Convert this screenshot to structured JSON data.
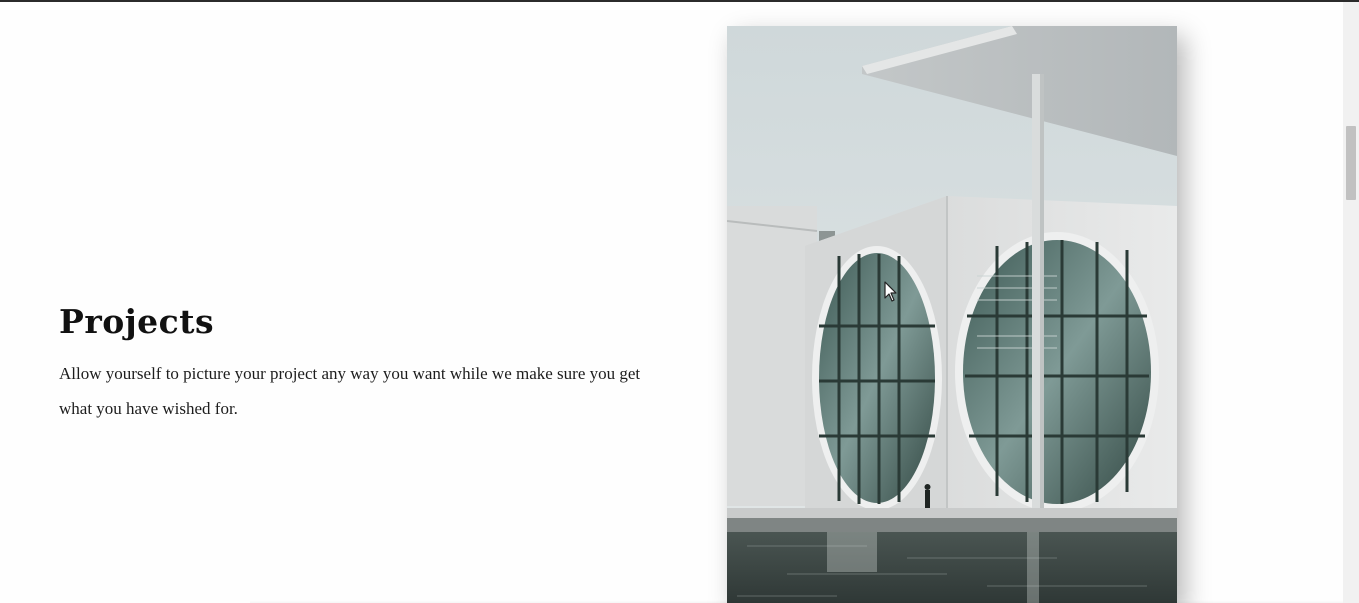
{
  "section": {
    "title": "Projects",
    "description": "Allow yourself to picture your project any way you want while we make sure you get what you have wished for."
  },
  "image": {
    "subject": "modern-architecture-circular-windows-photo"
  },
  "colors": {
    "title": "#111111",
    "body_text": "#1d1d1d",
    "background": "#fefefe",
    "scrollbar_track": "#f1f1f1",
    "scrollbar_thumb": "#c1c1c1"
  },
  "scrollbar": {
    "position_fraction": 0.2
  }
}
